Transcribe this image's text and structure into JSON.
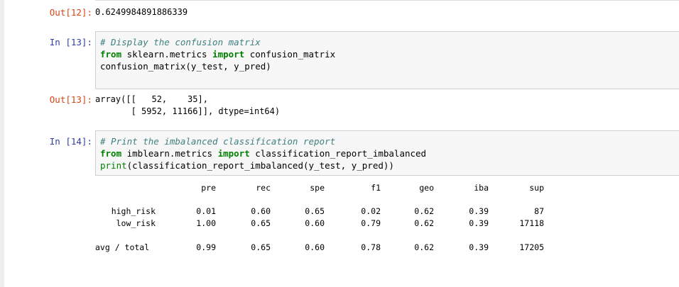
{
  "cell12": {
    "out_prompt": "Out[12]:",
    "output": "0.6249984891886339"
  },
  "cell13": {
    "in_prompt": "In [13]:",
    "comment": "# Display the confusion matrix",
    "line2_kw1": "from",
    "line2_mod": " sklearn.metrics ",
    "line2_kw2": "import",
    "line2_name": " confusion_matrix",
    "line3": "confusion_matrix(y_test, y_pred)",
    "out_prompt": "Out[13]:",
    "output_line1": "array([[   52,    35],",
    "output_line2": "       [ 5952, 11166]], dtype=int64)"
  },
  "cell14": {
    "in_prompt": "In [14]:",
    "comment": "# Print the imbalanced classification report",
    "line2_kw1": "from",
    "line2_mod": " imblearn.metrics ",
    "line2_kw2": "import",
    "line2_name": " classification_report_imbalanced",
    "line3_builtin": "print",
    "line3_rest": "(classification_report_imbalanced(y_test, y_pred))"
  },
  "report": {
    "headers": [
      "pre",
      "rec",
      "spe",
      "f1",
      "geo",
      "iba",
      "sup"
    ],
    "rows": [
      {
        "label": "high_risk",
        "values": [
          "0.01",
          "0.60",
          "0.65",
          "0.02",
          "0.62",
          "0.39",
          "87"
        ]
      },
      {
        "label": "low_risk",
        "values": [
          "1.00",
          "0.65",
          "0.60",
          "0.79",
          "0.62",
          "0.39",
          "17118"
        ]
      }
    ],
    "total": {
      "label": "avg / total",
      "values": [
        "0.99",
        "0.65",
        "0.60",
        "0.78",
        "0.62",
        "0.39",
        "17205"
      ]
    }
  }
}
